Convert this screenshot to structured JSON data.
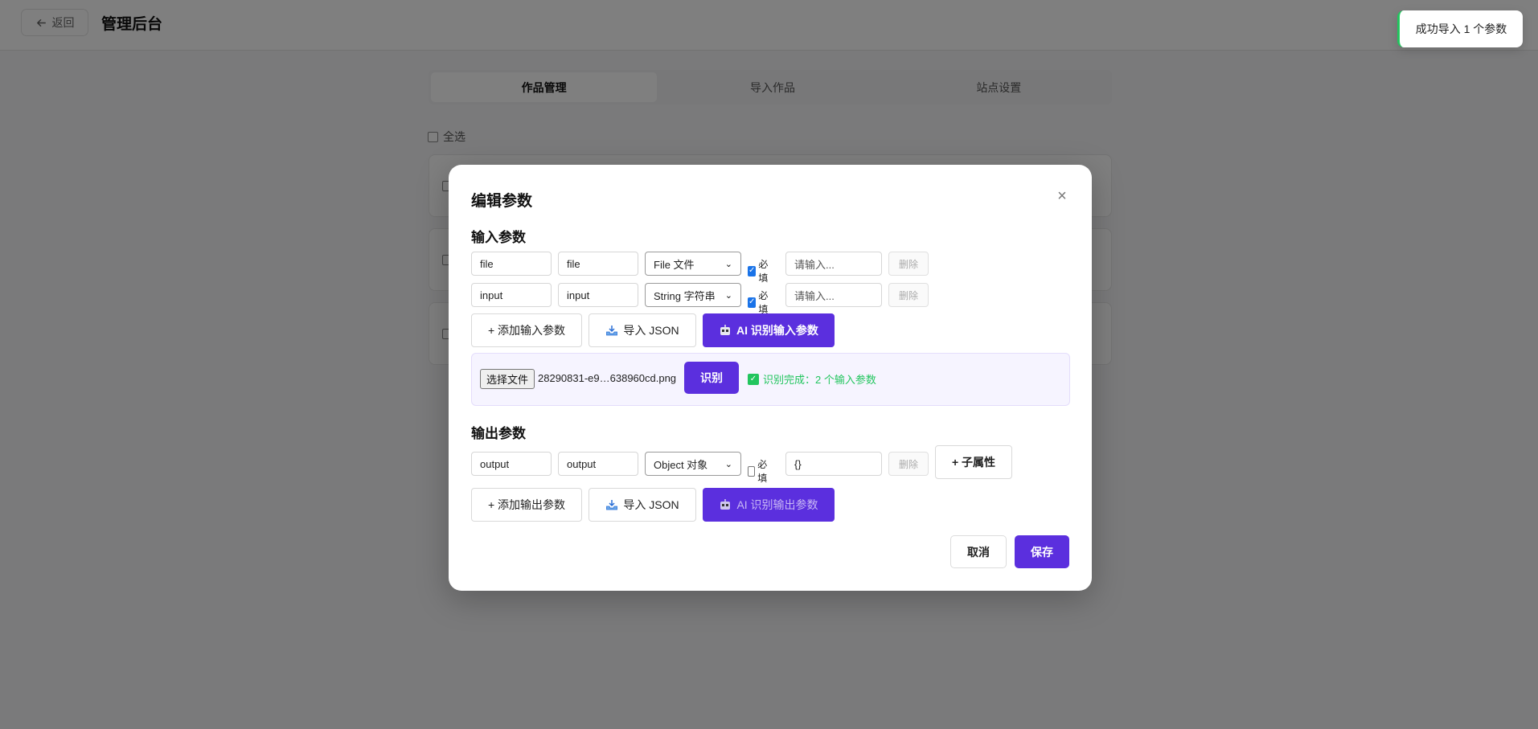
{
  "header": {
    "back_label": "返回",
    "title": "管理后台"
  },
  "tabs": [
    {
      "label": "作品管理",
      "active": true
    },
    {
      "label": "导入作品",
      "active": false
    },
    {
      "label": "站点设置",
      "active": false
    }
  ],
  "select_all_label": "全选",
  "toast": {
    "message": "成功导入 1 个参数",
    "accent_color": "#22c55e"
  },
  "modal": {
    "title": "编辑参数",
    "close_icon": "close-icon",
    "input_section": {
      "title": "输入参数",
      "params": [
        {
          "name": "file",
          "label": "file",
          "type": "File 文件",
          "required": true,
          "default_placeholder": "请输入...",
          "delete_label": "删除"
        },
        {
          "name": "input",
          "label": "input",
          "type": "String 字符串",
          "required": true,
          "default_placeholder": "请输入...",
          "delete_label": "删除"
        }
      ],
      "required_label": "必填",
      "add_button": "+ 添加输入参数",
      "import_json_button": "导入 JSON",
      "ai_button": "AI 识别输入参数"
    },
    "recognize": {
      "choose_file_label": "选择文件",
      "file_name": "28290831-e9…638960cd.png",
      "recognize_button": "识别",
      "status": "识别完成：2 个输入参数"
    },
    "output_section": {
      "title": "输出参数",
      "params": [
        {
          "name": "output",
          "label": "output",
          "type": "Object 对象",
          "required": false,
          "default_value": "{}",
          "delete_label": "删除",
          "child_button": "+ 子属性"
        }
      ],
      "required_label": "必填",
      "add_button": "+ 添加输出参数",
      "import_json_button": "导入 JSON",
      "ai_button": "AI 识别输出参数"
    },
    "cancel_button": "取消",
    "save_button": "保存"
  },
  "colors": {
    "primary": "#5b2fde",
    "success": "#22c55e",
    "checkbox": "#1a73e8"
  }
}
